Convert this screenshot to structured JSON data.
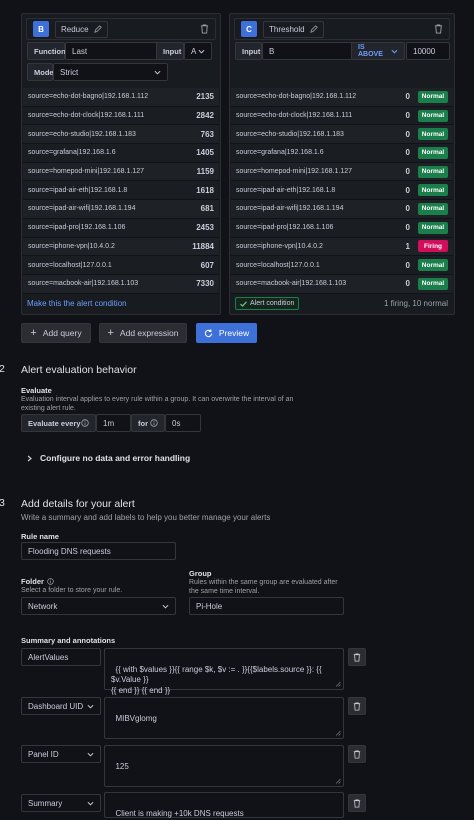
{
  "query_b": {
    "letter": "B",
    "name": "Reduce",
    "function_label": "Function",
    "function_value": "Last",
    "input_label": "Input",
    "input_value": "A",
    "mode_label": "Mode",
    "mode_value": "Strict",
    "rows": [
      {
        "source": "source=echo-dot-bagno|192.168.1.112",
        "value": "2135"
      },
      {
        "source": "source=echo-dot-clock|192.168.1.111",
        "value": "2842"
      },
      {
        "source": "source=echo-studio|192.168.1.183",
        "value": "763"
      },
      {
        "source": "source=grafana|192.168.1.6",
        "value": "1405"
      },
      {
        "source": "source=homepod-mini|192.168.1.127",
        "value": "1159"
      },
      {
        "source": "source=ipad-air-eth|192.168.1.8",
        "value": "1618"
      },
      {
        "source": "source=ipad-air-wifi|192.168.1.194",
        "value": "681"
      },
      {
        "source": "source=ipad-pro|192.168.1.106",
        "value": "2453"
      },
      {
        "source": "source=iphone-vpn|10.4.0.2",
        "value": "11884"
      },
      {
        "source": "source=localhost|127.0.0.1",
        "value": "607"
      },
      {
        "source": "source=macbook-air|192.168.1.103",
        "value": "7330"
      }
    ],
    "alert_condition_link": "Make this the alert condition"
  },
  "query_c": {
    "letter": "C",
    "name": "Threshold",
    "input_label": "Input",
    "input_value": "B",
    "operator": "IS ABOVE",
    "threshold": "10000",
    "rows": [
      {
        "source": "source=echo-dot-bagno|192.168.1.112",
        "value": "0",
        "state": "Normal"
      },
      {
        "source": "source=echo-dot-clock|192.168.1.111",
        "value": "0",
        "state": "Normal"
      },
      {
        "source": "source=echo-studio|192.168.1.183",
        "value": "0",
        "state": "Normal"
      },
      {
        "source": "source=grafana|192.168.1.6",
        "value": "0",
        "state": "Normal"
      },
      {
        "source": "source=homepod-mini|192.168.1.127",
        "value": "0",
        "state": "Normal"
      },
      {
        "source": "source=ipad-air-eth|192.168.1.8",
        "value": "0",
        "state": "Normal"
      },
      {
        "source": "source=ipad-air-wifi|192.168.1.194",
        "value": "0",
        "state": "Normal"
      },
      {
        "source": "source=ipad-pro|192.168.1.106",
        "value": "0",
        "state": "Normal"
      },
      {
        "source": "source=iphone-vpn|10.4.0.2",
        "value": "1",
        "state": "Firing"
      },
      {
        "source": "source=localhost|127.0.0.1",
        "value": "0",
        "state": "Normal"
      },
      {
        "source": "source=macbook-air|192.168.1.103",
        "value": "0",
        "state": "Normal"
      }
    ],
    "alert_condition_badge": "Alert condition",
    "summary": "1 firing, 10 normal"
  },
  "actions": {
    "add_query": "Add query",
    "add_expression": "Add expression",
    "preview": "Preview"
  },
  "step2": {
    "number": "2",
    "title": "Alert evaluation behavior",
    "evaluate_title": "Evaluate",
    "evaluate_desc": "Evaluation interval applies to every rule within a group. It can overwrite the interval of an existing alert rule.",
    "evaluate_every_label": "Evaluate every",
    "evaluate_every_value": "1m",
    "for_label": "for",
    "for_value": "0s",
    "nodata_label": "Configure no data and error handling"
  },
  "step3": {
    "number": "3",
    "title": "Add details for your alert",
    "subtitle": "Write a summary and add labels to help you better manage your alerts",
    "rule_name_label": "Rule name",
    "rule_name_value": "Flooding DNS requests",
    "folder_label": "Folder",
    "folder_desc": "Select a folder to store your rule.",
    "folder_value": "Network",
    "group_label": "Group",
    "group_desc": "Rules within the same group are evaluated after the same time interval.",
    "group_value": "Pi-Hole",
    "annotations_title": "Summary and annotations",
    "annotations": [
      {
        "key": "AlertValues",
        "value": "{{ with $values }}{{ range $k, $v := . }}{{$labels.source }}: {{ $v.Value }}\n{{ end }} {{ end }}"
      },
      {
        "key": "Dashboard UID",
        "value": "MIBVglomg"
      },
      {
        "key": "Panel ID",
        "value": "125"
      },
      {
        "key": "Summary",
        "value": "Client is making +10k DNS requests"
      }
    ]
  }
}
